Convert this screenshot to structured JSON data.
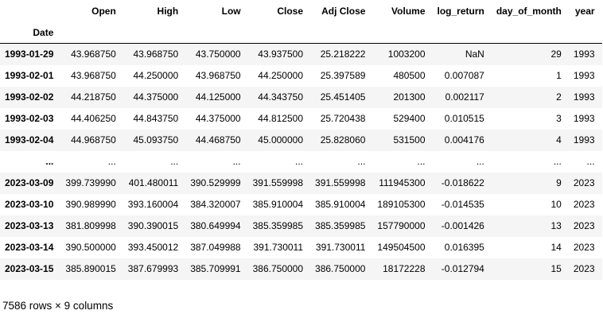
{
  "table": {
    "columns": [
      "Open",
      "High",
      "Low",
      "Close",
      "Adj Close",
      "Volume",
      "log_return",
      "day_of_month",
      "year"
    ],
    "index_name": "Date",
    "rows": [
      {
        "index": "1993-01-29",
        "cells": [
          "43.968750",
          "43.968750",
          "43.750000",
          "43.937500",
          "25.218222",
          "1003200",
          "NaN",
          "29",
          "1993"
        ]
      },
      {
        "index": "1993-02-01",
        "cells": [
          "43.968750",
          "44.250000",
          "43.968750",
          "44.250000",
          "25.397589",
          "480500",
          "0.007087",
          "1",
          "1993"
        ]
      },
      {
        "index": "1993-02-02",
        "cells": [
          "44.218750",
          "44.375000",
          "44.125000",
          "44.343750",
          "25.451405",
          "201300",
          "0.002117",
          "2",
          "1993"
        ]
      },
      {
        "index": "1993-02-03",
        "cells": [
          "44.406250",
          "44.843750",
          "44.375000",
          "44.812500",
          "25.720438",
          "529400",
          "0.010515",
          "3",
          "1993"
        ]
      },
      {
        "index": "1993-02-04",
        "cells": [
          "44.968750",
          "45.093750",
          "44.468750",
          "45.000000",
          "25.828060",
          "531500",
          "0.004176",
          "4",
          "1993"
        ]
      },
      {
        "index": "...",
        "cells": [
          "...",
          "...",
          "...",
          "...",
          "...",
          "...",
          "...",
          "...",
          "..."
        ]
      },
      {
        "index": "2023-03-09",
        "cells": [
          "399.739990",
          "401.480011",
          "390.529999",
          "391.559998",
          "391.559998",
          "111945300",
          "-0.018622",
          "9",
          "2023"
        ]
      },
      {
        "index": "2023-03-10",
        "cells": [
          "390.989990",
          "393.160004",
          "384.320007",
          "385.910004",
          "385.910004",
          "189105300",
          "-0.014535",
          "10",
          "2023"
        ]
      },
      {
        "index": "2023-03-13",
        "cells": [
          "381.809998",
          "390.390015",
          "380.649994",
          "385.359985",
          "385.359985",
          "157790000",
          "-0.001426",
          "13",
          "2023"
        ]
      },
      {
        "index": "2023-03-14",
        "cells": [
          "390.500000",
          "393.450012",
          "387.049988",
          "391.730011",
          "391.730011",
          "149504500",
          "0.016395",
          "14",
          "2023"
        ]
      },
      {
        "index": "2023-03-15",
        "cells": [
          "385.890015",
          "387.679993",
          "385.709991",
          "386.750000",
          "386.750000",
          "18172228",
          "-0.012794",
          "15",
          "2023"
        ]
      }
    ]
  },
  "footer": {
    "shape_text": "7586 rows × 9 columns"
  }
}
